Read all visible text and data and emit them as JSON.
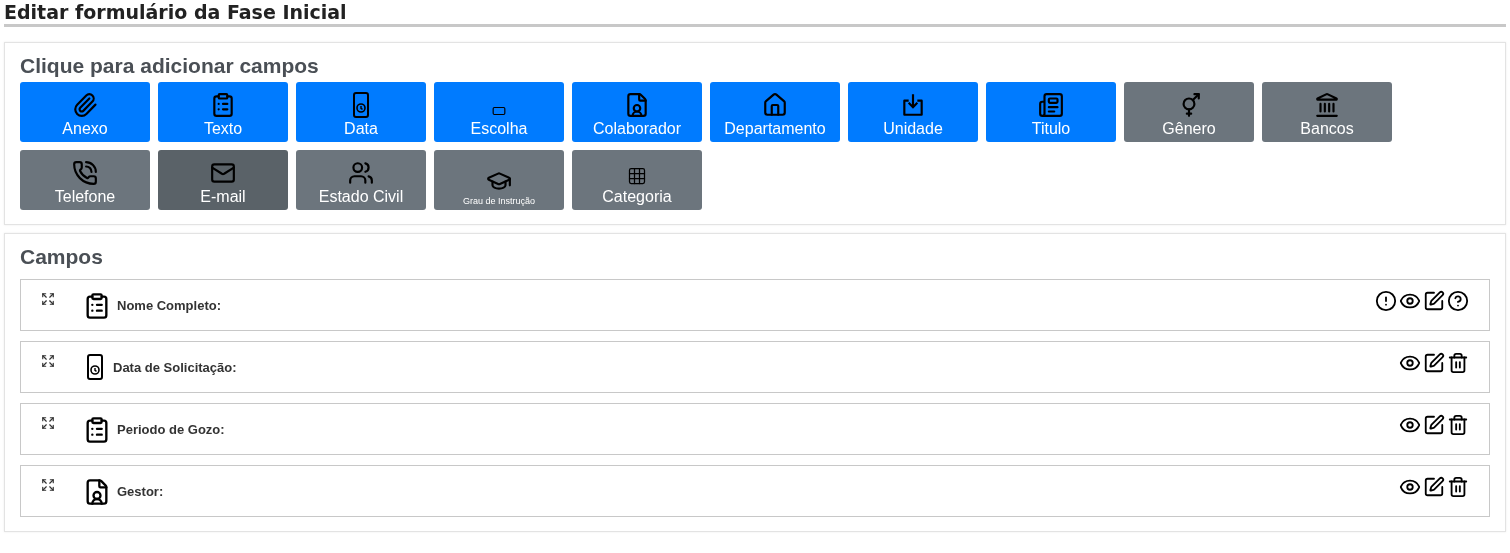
{
  "page_title": "Editar formulário da Fase Inicial",
  "palette": {
    "title": "Clique para adicionar campos",
    "buttons": [
      {
        "kind": "attachment",
        "label": "Anexo",
        "color": "#007bff",
        "compact": false
      },
      {
        "kind": "text",
        "label": "Texto",
        "color": "#007bff",
        "compact": false
      },
      {
        "kind": "date",
        "label": "Data",
        "color": "#007bff",
        "compact": false
      },
      {
        "kind": "choice",
        "label": "Escolha",
        "color": "#007bff",
        "compact": false
      },
      {
        "kind": "employee",
        "label": "Colaborador",
        "color": "#007bff",
        "compact": false
      },
      {
        "kind": "department",
        "label": "Departamento",
        "color": "#007bff",
        "compact": false
      },
      {
        "kind": "unit",
        "label": "Unidade",
        "color": "#007bff",
        "compact": false
      },
      {
        "kind": "heading",
        "label": "Titulo",
        "color": "#007bff",
        "compact": false
      },
      {
        "kind": "gender",
        "label": "Gênero",
        "color": "#6c757d",
        "compact": false
      },
      {
        "kind": "bank",
        "label": "Bancos",
        "color": "#6c757d",
        "compact": false
      },
      {
        "kind": "phone",
        "label": "Telefone",
        "color": "#6c757d",
        "compact": false
      },
      {
        "kind": "email",
        "label": "E-mail",
        "color": "#5a6268",
        "compact": false
      },
      {
        "kind": "marital",
        "label": "Estado Civil",
        "color": "#6c757d",
        "compact": false
      },
      {
        "kind": "education",
        "label": "Grau de Instrução",
        "color": "#6c757d",
        "compact": true
      },
      {
        "kind": "category",
        "label": "Categoria",
        "color": "#6c757d",
        "compact": false
      }
    ]
  },
  "fields": {
    "title": "Campos",
    "rows": [
      {
        "kind": "text",
        "label": "Nome Completo:",
        "actions": [
          {
            "kind": "required"
          },
          {
            "kind": "view"
          },
          {
            "kind": "edit"
          },
          {
            "kind": "help"
          }
        ]
      },
      {
        "kind": "date",
        "label": "Data de Solicitação:",
        "actions": [
          {
            "kind": "view"
          },
          {
            "kind": "edit"
          },
          {
            "kind": "delete"
          }
        ]
      },
      {
        "kind": "text",
        "label": "Periodo de Gozo:",
        "actions": [
          {
            "kind": "view"
          },
          {
            "kind": "edit"
          },
          {
            "kind": "delete"
          }
        ]
      },
      {
        "kind": "employee",
        "label": "Gestor:",
        "actions": [
          {
            "kind": "view"
          },
          {
            "kind": "edit"
          },
          {
            "kind": "delete"
          }
        ]
      }
    ]
  }
}
